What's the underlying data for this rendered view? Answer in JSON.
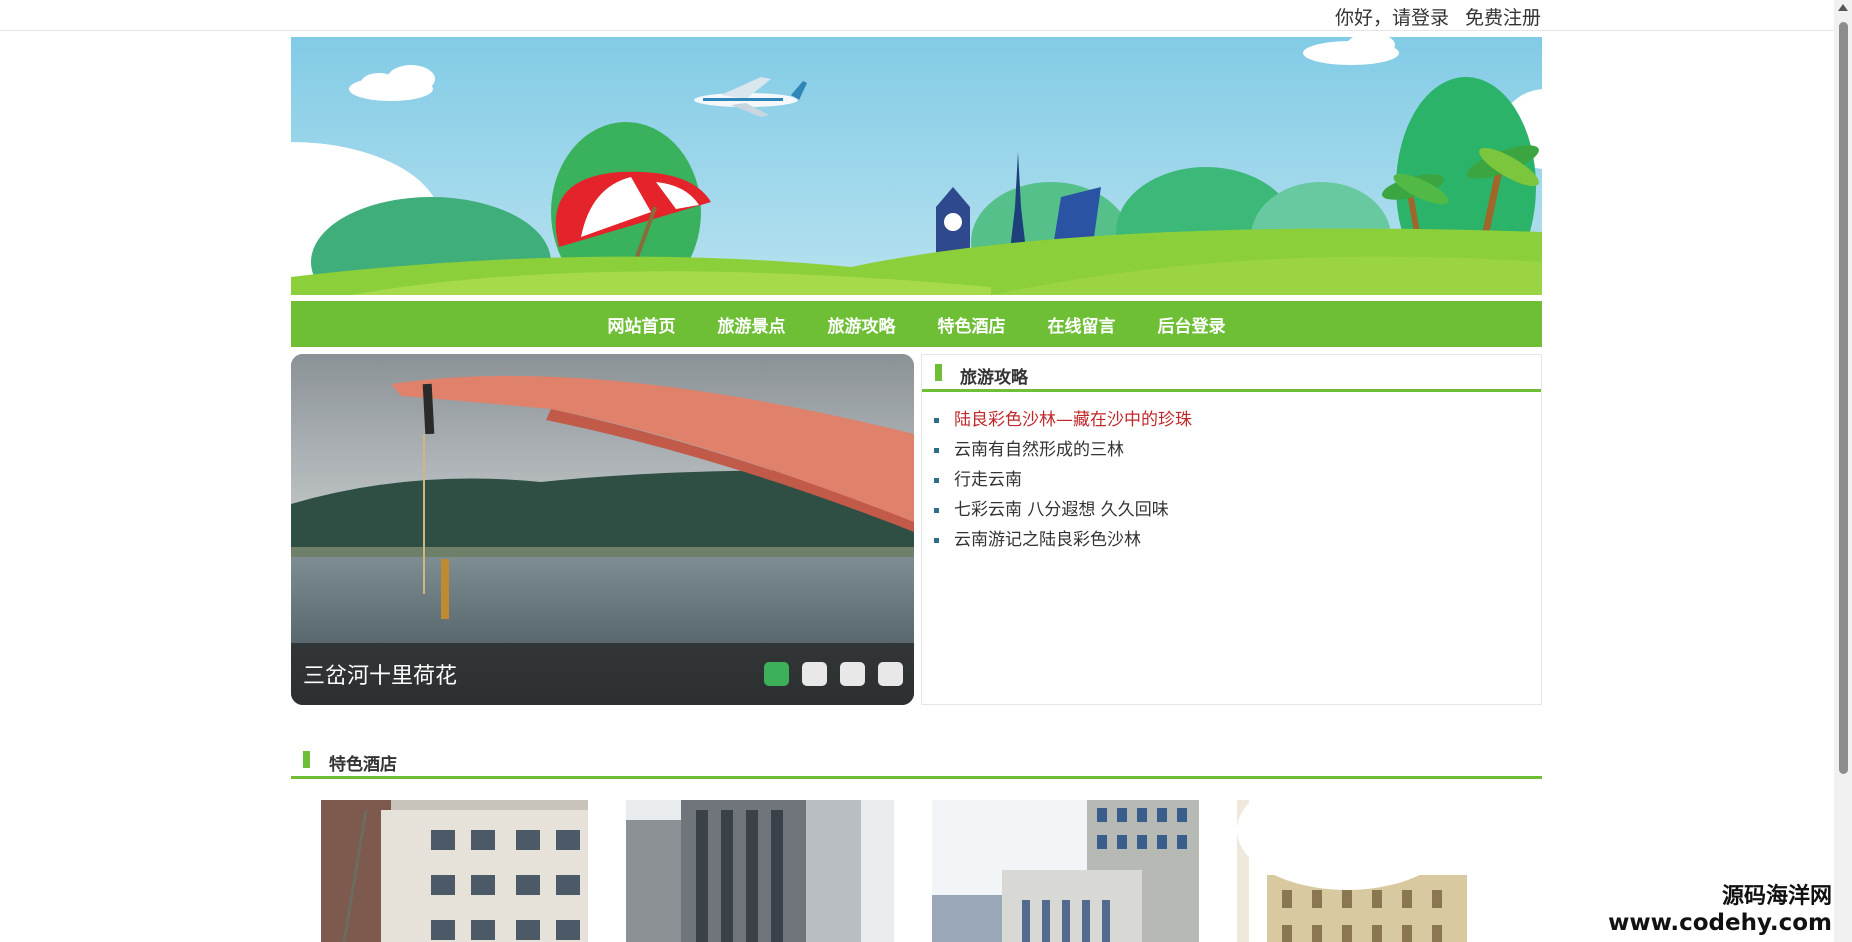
{
  "topbar": {
    "greeting": "你好，",
    "login": "请登录",
    "register": "免费注册"
  },
  "nav": {
    "items": [
      "网站首页",
      "旅游景点",
      "旅游攻略",
      "特色酒店",
      "在线留言",
      "后台登录"
    ]
  },
  "slider": {
    "caption": "三岔河十里荷花",
    "slide_count": 4,
    "active_index": 0
  },
  "guide": {
    "title": "旅游攻略",
    "items": [
      "陆良彩色沙林—藏在沙中的珍珠",
      "云南有自然形成的三林",
      "行走云南",
      "七彩云南 八分遐想 久久回味",
      "云南游记之陆良彩色沙林"
    ],
    "active_index": 0
  },
  "hotels": {
    "title": "特色酒店"
  },
  "watermark": {
    "line1": "源码海洋网",
    "line2": "www.codehy.com"
  },
  "colors": {
    "brand_green": "#6ebe36",
    "link_active": "#c0282b",
    "dot_active": "#3db05a"
  }
}
